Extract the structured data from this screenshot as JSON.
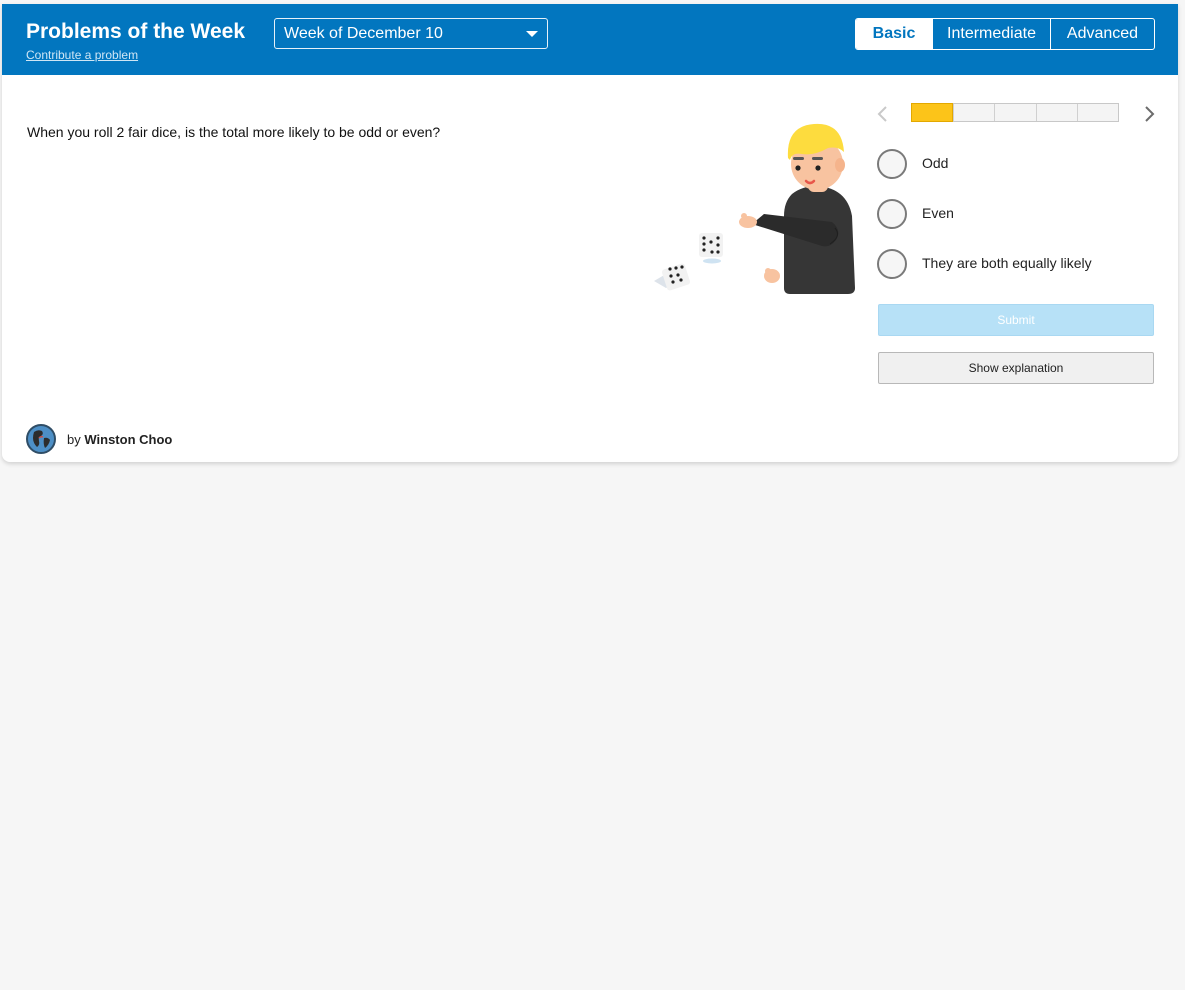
{
  "header": {
    "title": "Problems of the Week",
    "contribute_link": "Contribute a problem",
    "week_select": {
      "selected": "Week of December 10"
    },
    "levels": [
      {
        "label": "Basic",
        "selected": true
      },
      {
        "label": "Intermediate",
        "selected": false
      },
      {
        "label": "Advanced",
        "selected": false
      }
    ]
  },
  "problem": {
    "question": "When you roll 2 fair dice, is the total more likely to be odd or even?",
    "illustration_icon": "person-rolling-dice-illustration"
  },
  "progress": {
    "total_segments": 5,
    "completed_segments": 1,
    "fill_color": "#fcc419"
  },
  "answers": {
    "options": [
      {
        "label": "Odd"
      },
      {
        "label": "Even"
      },
      {
        "label": "They are both equally likely"
      }
    ],
    "submit_label": "Submit",
    "explanation_label": "Show explanation"
  },
  "author": {
    "by": "by",
    "name": "Winston Choo",
    "avatar_icon": "globe-avatar-icon"
  },
  "colors": {
    "header_bg": "#0276bf",
    "submit_disabled": "#b7e1f7",
    "page_bg": "#f6f6f6"
  }
}
